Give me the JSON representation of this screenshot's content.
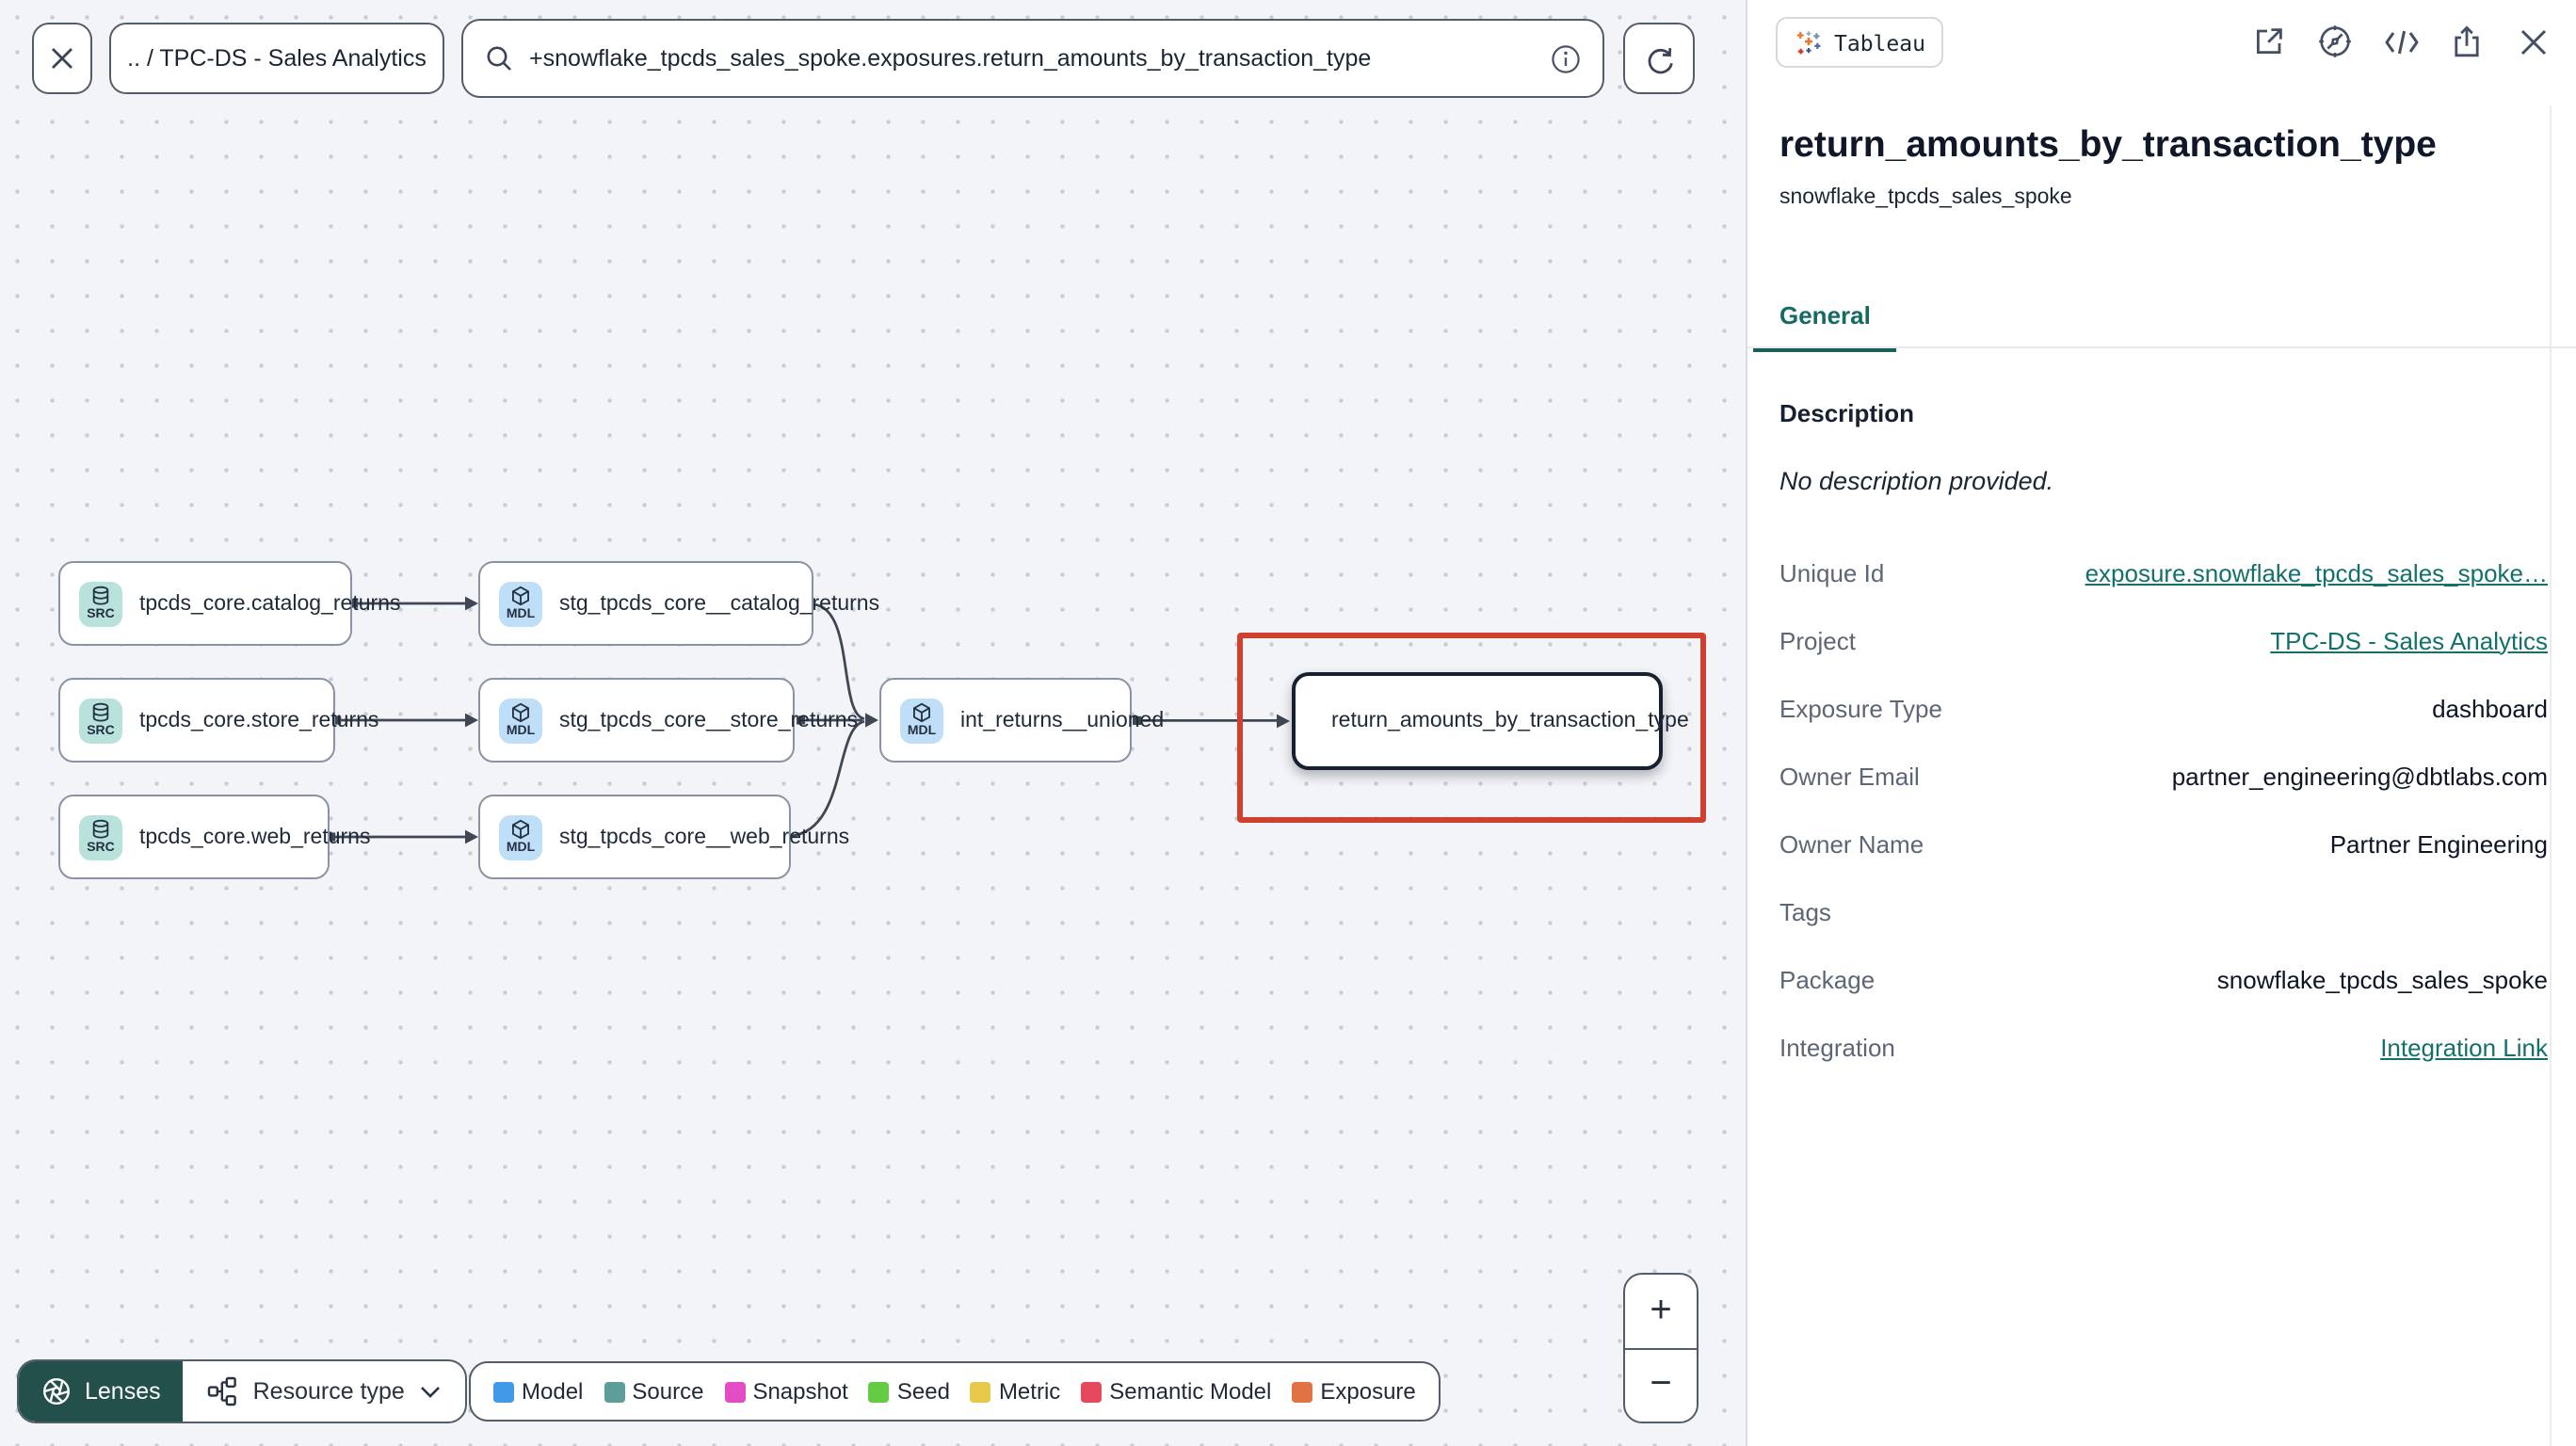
{
  "topbar": {
    "breadcrumb": ".. / TPC-DS - Sales Analytics",
    "search_value": "+snowflake_tpcds_sales_spoke.exposures.return_amounts_by_transaction_type",
    "icons": [
      "close-icon",
      "search-icon",
      "info-icon",
      "refresh-icon"
    ]
  },
  "graph": {
    "nodes": [
      {
        "badge": "SRC",
        "label": "tpcds_core.catalog_returns",
        "type": "source"
      },
      {
        "badge": "MDL",
        "label": "stg_tpcds_core__catalog_returns",
        "type": "model"
      },
      {
        "badge": "SRC",
        "label": "tpcds_core.store_returns",
        "type": "source"
      },
      {
        "badge": "MDL",
        "label": "stg_tpcds_core__store_returns",
        "type": "model"
      },
      {
        "badge": "SRC",
        "label": "tpcds_core.web_returns",
        "type": "source"
      },
      {
        "badge": "MDL",
        "label": "stg_tpcds_core__web_returns",
        "type": "model"
      },
      {
        "badge": "MDL",
        "label": "int_returns__unioned",
        "type": "model"
      },
      {
        "label": "return_amounts_by_transaction_type",
        "type": "exposure",
        "icon": "tableau-icon",
        "selected": true
      }
    ]
  },
  "controls": {
    "lenses_label": "Lenses",
    "resource_type_label": "Resource type",
    "zoom_in": "+",
    "zoom_out": "−"
  },
  "legend": {
    "items": [
      {
        "label": "Model",
        "color": "#4299e8"
      },
      {
        "label": "Source",
        "color": "#5e9e9a"
      },
      {
        "label": "Snapshot",
        "color": "#e34cc5"
      },
      {
        "label": "Seed",
        "color": "#63cb44"
      },
      {
        "label": "Metric",
        "color": "#e6c84a"
      },
      {
        "label": "Semantic Model",
        "color": "#e6485d"
      },
      {
        "label": "Exposure",
        "color": "#e07243"
      }
    ]
  },
  "panel": {
    "integration_badge": "Tableau",
    "header_icons": [
      "open-in-new-icon",
      "explore-compass-icon",
      "code-icon",
      "share-icon",
      "close-icon"
    ],
    "title": "return_amounts_by_transaction_type",
    "subtitle": "snowflake_tpcds_sales_spoke",
    "tabs": [
      {
        "label": "General",
        "active": true
      }
    ],
    "description_heading": "Description",
    "description_value": "No description provided.",
    "fields": [
      {
        "label": "Unique Id",
        "value": "exposure.snowflake_tpcds_sales_spoke…",
        "link": true
      },
      {
        "label": "Project",
        "value": "TPC-DS - Sales Analytics",
        "link": true
      },
      {
        "label": "Exposure Type",
        "value": "dashboard",
        "link": false
      },
      {
        "label": "Owner Email",
        "value": "partner_engineering@dbtlabs.com",
        "link": false
      },
      {
        "label": "Owner Name",
        "value": "Partner Engineering",
        "link": false
      },
      {
        "label": "Tags",
        "value": "",
        "link": false
      },
      {
        "label": "Package",
        "value": "snowflake_tpcds_sales_spoke",
        "link": false
      },
      {
        "label": "Integration",
        "value": "Integration Link",
        "link": true
      }
    ],
    "colors": {
      "accent_teal": "#14706a",
      "highlight_red": "#d0402e",
      "lenses_green": "#23504a"
    }
  }
}
